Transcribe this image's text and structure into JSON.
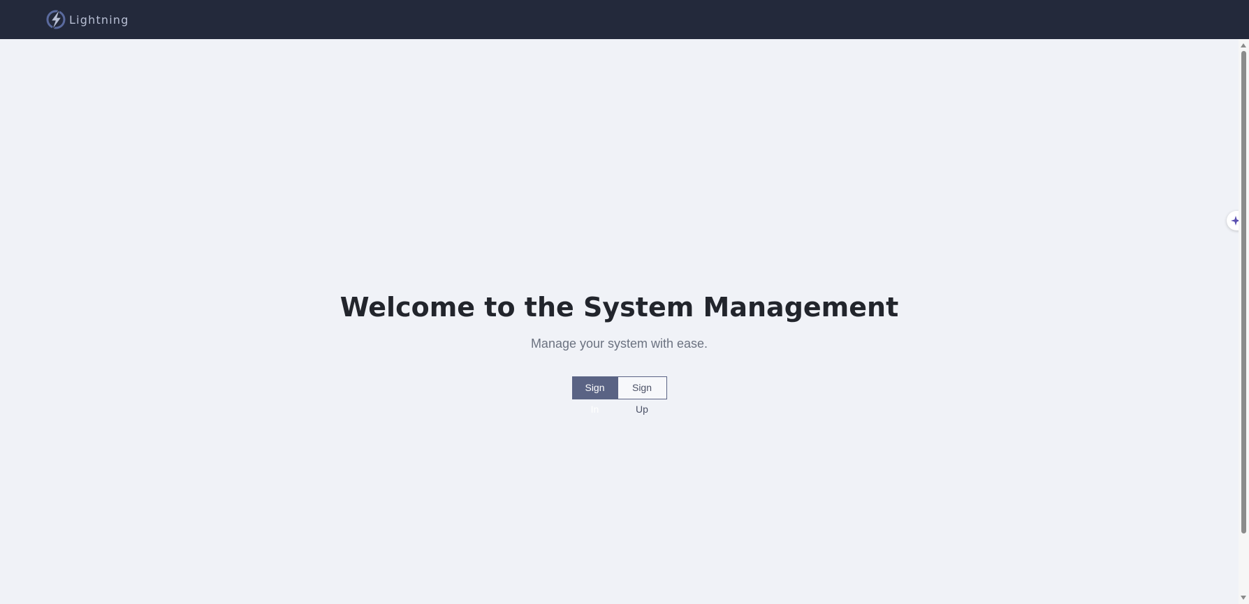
{
  "header": {
    "brand_name": "Lightning",
    "logo_icon": "lightning-bolt-icon"
  },
  "hero": {
    "title": "Welcome to the System Management",
    "subtitle": "Manage your system with ease."
  },
  "auth": {
    "sign_in_label": "Sign In",
    "sign_up_label": "Sign Up"
  },
  "side_widget": {
    "icon": "sparkle-icon"
  },
  "colors": {
    "topbar": "#23293b",
    "background": "#f0f2f7",
    "primary_button": "#5a6384"
  }
}
